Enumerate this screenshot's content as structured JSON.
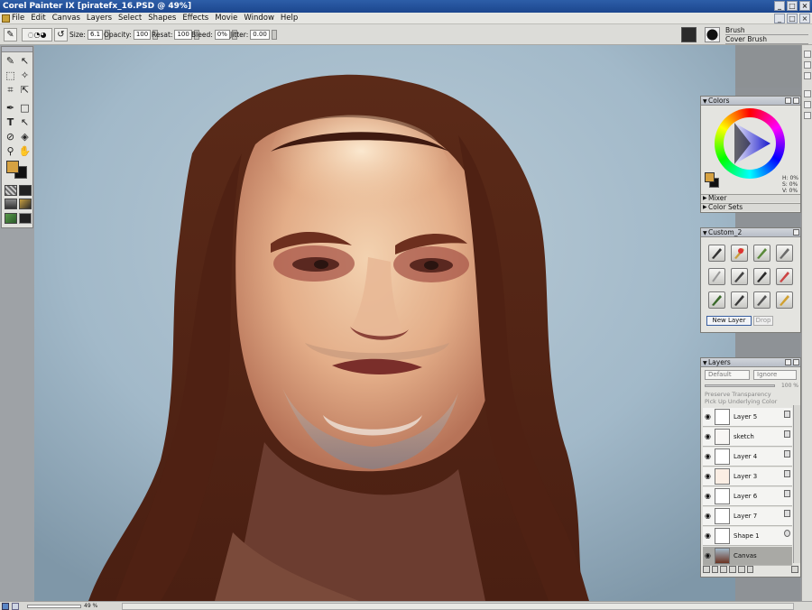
{
  "window": {
    "title": "Corel Painter IX   [piratefx_16.PSD @ 49%]",
    "buttons": [
      "_",
      "□",
      "×"
    ]
  },
  "menubar": {
    "items": [
      "File",
      "Edit",
      "Canvas",
      "Layers",
      "Select",
      "Shapes",
      "Effects",
      "Movie",
      "Window",
      "Help"
    ]
  },
  "propbar": {
    "size_label": "Size:",
    "size_value": "6.1",
    "opacity_label": "Opacity:",
    "opacity_value": "100",
    "resat_label": "Resat:",
    "resat_value": "100",
    "bleed_label": "Bleed:",
    "bleed_value": "0%",
    "jitter_label": "Jitter:",
    "jitter_value": "0.00",
    "brush_category": "Brush",
    "brush_variant": "Cover Brush"
  },
  "colors": {
    "main_color": "#d6a242",
    "additional_color": "#111111",
    "panel_title": "Colors",
    "hsv": [
      "H: 0%",
      "S: 0%",
      "V: 0%"
    ],
    "mixer_label": "Mixer",
    "color_sets_label": "Color Sets"
  },
  "custom": {
    "panel_title": "Custom_2",
    "new_layer_label": "New Layer",
    "drop_label": "Drop"
  },
  "layers": {
    "panel_title": "Layers",
    "composite_method": "Default",
    "composite_depth": "Ignore",
    "opacity_value": "100 %",
    "preserve_transparency": "Preserve Transparency",
    "pick_up_underlying": "Pick Up Underlying Color",
    "items": [
      {
        "name": "Layer 5"
      },
      {
        "name": "sketch"
      },
      {
        "name": "Layer 4"
      },
      {
        "name": "Layer 3"
      },
      {
        "name": "Layer 6"
      },
      {
        "name": "Layer 7"
      },
      {
        "name": "Shape 1"
      },
      {
        "name": "Canvas"
      }
    ]
  },
  "statusbar": {
    "zoom": "49 %"
  }
}
